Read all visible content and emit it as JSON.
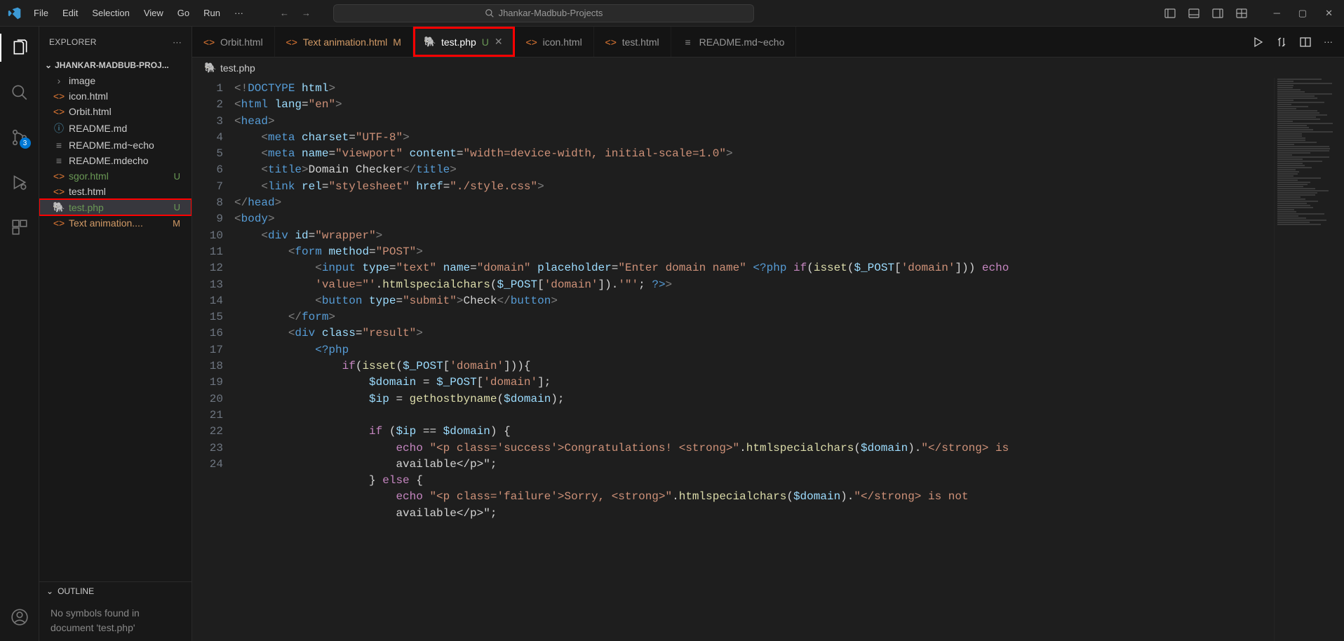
{
  "titlebar": {
    "menus": [
      "File",
      "Edit",
      "Selection",
      "View",
      "Go",
      "Run",
      "···"
    ],
    "search_label": "Jhankar-Madbub-Projects"
  },
  "activitybar": {
    "scm_badge": "3"
  },
  "sidebar": {
    "title": "EXPLORER",
    "project": "JHANKAR-MADBUB-PROJ...",
    "files": [
      {
        "name": "image",
        "icon": "folder",
        "status": ""
      },
      {
        "name": "icon.html",
        "icon": "html",
        "status": ""
      },
      {
        "name": "Orbit.html",
        "icon": "html",
        "status": ""
      },
      {
        "name": "README.md",
        "icon": "info",
        "status": ""
      },
      {
        "name": "README.md~echo",
        "icon": "file",
        "status": ""
      },
      {
        "name": "README.mdecho",
        "icon": "file",
        "status": ""
      },
      {
        "name": "sgor.html",
        "icon": "html",
        "status": "U"
      },
      {
        "name": "test.html",
        "icon": "html",
        "status": ""
      },
      {
        "name": "test.php",
        "icon": "php",
        "status": "U",
        "selected": true
      },
      {
        "name": "Text animation....",
        "icon": "html",
        "status": "M"
      }
    ],
    "outline": {
      "title": "OUTLINE",
      "message": "No symbols found in document 'test.php'"
    }
  },
  "tabs": {
    "items": [
      {
        "label": "Orbit.html",
        "icon": "html",
        "badge": ""
      },
      {
        "label": "Text animation.html",
        "icon": "html",
        "badge": "M"
      },
      {
        "label": "test.php",
        "icon": "php",
        "badge": "U",
        "active": true,
        "closeable": true,
        "highlighted": true
      },
      {
        "label": "icon.html",
        "icon": "html",
        "badge": ""
      },
      {
        "label": "test.html",
        "icon": "html",
        "badge": ""
      },
      {
        "label": "README.md~echo",
        "icon": "file",
        "badge": ""
      }
    ]
  },
  "breadcrumb": {
    "icon": "php",
    "file": "test.php"
  },
  "code": {
    "lines": [
      {
        "n": 1,
        "html": "<span class='c-br'>&lt;!</span><span class='c-doctype'>DOCTYPE</span> <span class='c-attr'>html</span><span class='c-br'>&gt;</span>"
      },
      {
        "n": 2,
        "html": "<span class='c-br'>&lt;</span><span class='c-tag'>html</span> <span class='c-attr'>lang</span>=<span class='c-str'>\"en\"</span><span class='c-br'>&gt;</span>"
      },
      {
        "n": 3,
        "html": "<span class='c-br'>&lt;</span><span class='c-tag'>head</span><span class='c-br'>&gt;</span>"
      },
      {
        "n": 4,
        "html": "    <span class='c-br'>&lt;</span><span class='c-tag'>meta</span> <span class='c-attr'>charset</span>=<span class='c-str'>\"UTF-8\"</span><span class='c-br'>&gt;</span>"
      },
      {
        "n": 5,
        "html": "    <span class='c-br'>&lt;</span><span class='c-tag'>meta</span> <span class='c-attr'>name</span>=<span class='c-str'>\"viewport\"</span> <span class='c-attr'>content</span>=<span class='c-str'>\"width=device-width, initial-scale=1.0\"</span><span class='c-br'>&gt;</span>"
      },
      {
        "n": 6,
        "html": "    <span class='c-br'>&lt;</span><span class='c-tag'>title</span><span class='c-br'>&gt;</span>Domain Checker<span class='c-br'>&lt;/</span><span class='c-tag'>title</span><span class='c-br'>&gt;</span>"
      },
      {
        "n": 7,
        "html": "    <span class='c-br'>&lt;</span><span class='c-tag'>link</span> <span class='c-attr'>rel</span>=<span class='c-str'>\"stylesheet\"</span> <span class='c-attr'>href</span>=<span class='c-str'>\"./style.css\"</span><span class='c-br'>&gt;</span>"
      },
      {
        "n": 8,
        "html": "<span class='c-br'>&lt;/</span><span class='c-tag'>head</span><span class='c-br'>&gt;</span>"
      },
      {
        "n": 9,
        "html": "<span class='c-br'>&lt;</span><span class='c-tag'>body</span><span class='c-br'>&gt;</span>"
      },
      {
        "n": 10,
        "html": "    <span class='c-br'>&lt;</span><span class='c-tag'>div</span> <span class='c-attr'>id</span>=<span class='c-str'>\"wrapper\"</span><span class='c-br'>&gt;</span>"
      },
      {
        "n": 11,
        "html": "        <span class='c-br'>&lt;</span><span class='c-tag'>form</span> <span class='c-attr'>method</span>=<span class='c-str'>\"POST\"</span><span class='c-br'>&gt;</span>"
      },
      {
        "n": 12,
        "html": "            <span class='c-br'>&lt;</span><span class='c-tag'>input</span> <span class='c-attr'>type</span>=<span class='c-str'>\"text\"</span> <span class='c-attr'>name</span>=<span class='c-str'>\"domain\"</span> <span class='c-attr'>placeholder</span>=<span class='c-str'>\"Enter domain name\"</span> <span class='c-php'>&lt;?php</span> <span class='c-kw'>if</span>(<span class='c-fn'>isset</span>(<span class='c-var'>$_POST</span>[<span class='c-str'>'domain'</span>])) <span class='c-kw'>echo</span>\n            <span class='c-str'>'value=\"'</span>.<span class='c-fn'>htmlspecialchars</span>(<span class='c-var'>$_POST</span>[<span class='c-str'>'domain'</span>]).<span class='c-str'>'\"'</span>; <span class='c-php'>?&gt;</span><span class='c-br'>&gt;</span>"
      },
      {
        "n": 13,
        "html": "            <span class='c-br'>&lt;</span><span class='c-tag'>button</span> <span class='c-attr'>type</span>=<span class='c-str'>\"submit\"</span><span class='c-br'>&gt;</span>Check<span class='c-br'>&lt;/</span><span class='c-tag'>button</span><span class='c-br'>&gt;</span>"
      },
      {
        "n": 14,
        "html": "        <span class='c-br'>&lt;/</span><span class='c-tag'>form</span><span class='c-br'>&gt;</span>"
      },
      {
        "n": 15,
        "html": "        <span class='c-br'>&lt;</span><span class='c-tag'>div</span> <span class='c-attr'>class</span>=<span class='c-str'>\"result\"</span><span class='c-br'>&gt;</span>"
      },
      {
        "n": 16,
        "html": "            <span class='c-php'>&lt;?php</span>"
      },
      {
        "n": 17,
        "html": "                <span class='c-kw'>if</span>(<span class='c-fn'>isset</span>(<span class='c-var'>$_POST</span>[<span class='c-str'>'domain'</span>])){"
      },
      {
        "n": 18,
        "html": "                    <span class='c-var'>$domain</span> = <span class='c-var'>$_POST</span>[<span class='c-str'>'domain'</span>];"
      },
      {
        "n": 19,
        "html": "                    <span class='c-var'>$ip</span> = <span class='c-fn'>gethostbyname</span>(<span class='c-var'>$domain</span>);"
      },
      {
        "n": 20,
        "html": ""
      },
      {
        "n": 21,
        "html": "                    <span class='c-kw'>if</span> (<span class='c-var'>$ip</span> == <span class='c-var'>$domain</span>) {"
      },
      {
        "n": 22,
        "html": "                        <span class='c-kw'>echo</span> <span class='c-str'>\"&lt;p class='success'&gt;Congratulations! &lt;strong&gt;\"</span>.<span class='c-fn'>htmlspecialchars</span>(<span class='c-var'>$domain</span>).<span class='c-str'>\"&lt;/strong&gt; is \n                        available&lt;/p&gt;\"</span>;"
      },
      {
        "n": 23,
        "html": "                    } <span class='c-kw'>else</span> {"
      },
      {
        "n": 24,
        "html": "                        <span class='c-kw'>echo</span> <span class='c-str'>\"&lt;p class='failure'&gt;Sorry, &lt;strong&gt;\"</span>.<span class='c-fn'>htmlspecialchars</span>(<span class='c-var'>$domain</span>).<span class='c-str'>\"&lt;/strong&gt; is not \n                        available&lt;/p&gt;\"</span>;"
      }
    ]
  }
}
